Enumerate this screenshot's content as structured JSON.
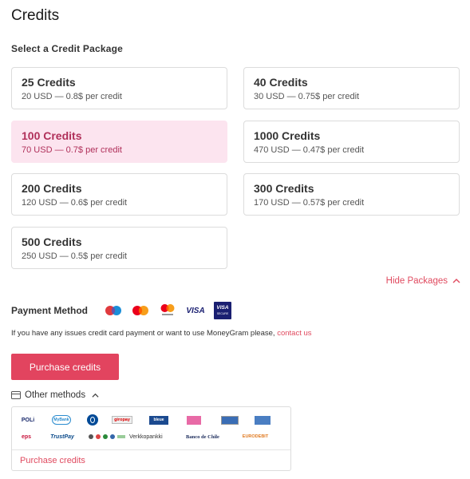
{
  "page": {
    "title": "Credits"
  },
  "packages": {
    "section_label": "Select a Credit Package",
    "items": [
      {
        "title": "25 Credits",
        "subtitle": "20 USD — 0.8$ per credit"
      },
      {
        "title": "40 Credits",
        "subtitle": "30 USD — 0.75$ per credit"
      },
      {
        "title": "100 Credits",
        "subtitle": "70 USD — 0.7$ per credit",
        "selected": true
      },
      {
        "title": "1000 Credits",
        "subtitle": "470 USD — 0.47$ per credit"
      },
      {
        "title": "200 Credits",
        "subtitle": "120 USD — 0.6$ per credit"
      },
      {
        "title": "300 Credits",
        "subtitle": "170 USD — 0.57$ per credit"
      },
      {
        "title": "500 Credits",
        "subtitle": "250 USD — 0.5$ per credit"
      }
    ],
    "hide_label": "Hide Packages"
  },
  "payment": {
    "label": "Payment Method",
    "icons": [
      "maestro-icon",
      "mastercard-icon",
      "mastercard-securecode-icon",
      "visa-icon",
      "visa-secure-icon"
    ],
    "icon_texts": {
      "visa": "VISA",
      "visa_secure_top": "VISA",
      "visa_secure_bottom": "SECURE"
    },
    "notice_text": "If you have any issues credit card payment or want to use MoneyGram please,",
    "notice_link": "contact us",
    "purchase_label": "Purchase credits"
  },
  "other_methods": {
    "label": "Other methods",
    "row1": [
      "POLi",
      "MyBank",
      "Diners",
      "giropay",
      "bleue",
      "card",
      "Multibanco",
      "Przelewy"
    ],
    "row2": [
      "eps",
      "TrustPay",
      "Verkkopankki",
      "Banco de Chile",
      "EURODEBIT"
    ],
    "purchase_label": "Purchase credits"
  },
  "colors": {
    "accent": "#e2445f",
    "selected_bg": "#fce4ef",
    "selected_text": "#b0305a"
  }
}
